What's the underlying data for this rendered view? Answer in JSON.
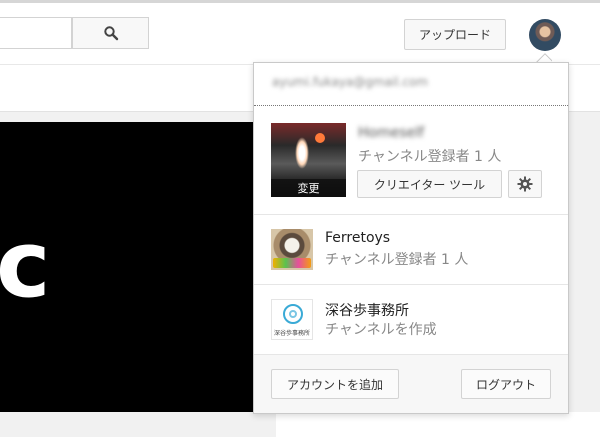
{
  "header": {
    "search": {
      "value": "",
      "placeholder": ""
    },
    "search_icon": "search-icon",
    "upload_label": "アップロード",
    "avatar_icon": "avatar"
  },
  "video": {
    "glyph": "c"
  },
  "menu": {
    "email": "ayumi.fukaya@gmail.com",
    "primary": {
      "name": "Homeself",
      "change_label": "変更",
      "subscribers": "チャンネル登録者 1 人",
      "creator_tools_label": "クリエイター ツール",
      "settings_icon": "gear-icon"
    },
    "accounts": [
      {
        "name": "Ferretoys",
        "subtitle": "チャンネル登録者 1 人"
      },
      {
        "name": "深谷歩事務所",
        "subtitle": "チャンネルを作成",
        "logo_caption": "深谷歩事務所"
      }
    ],
    "footer": {
      "add_account_label": "アカウントを追加",
      "logout_label": "ログアウト"
    }
  },
  "colors": {
    "accent_blue": "#3aaad6",
    "video_bg": "#000000",
    "menu_border": "#c9c9c9"
  }
}
